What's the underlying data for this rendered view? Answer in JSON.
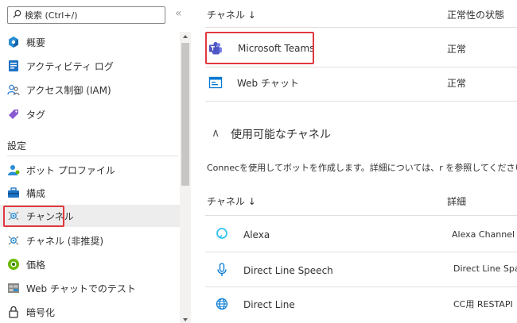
{
  "sidebar": {
    "search_placeholder": "検索 (Ctrl+/)",
    "collapse_glyph": "«",
    "items_top": [
      {
        "label": "概要",
        "icon": "overview-icon"
      },
      {
        "label": "アクティビティ ログ",
        "icon": "activity-log-icon"
      },
      {
        "label": "アクセス制御 (IAM)",
        "icon": "access-control-icon"
      },
      {
        "label": "タグ",
        "icon": "tag-icon"
      }
    ],
    "section_title": "設定",
    "items_settings": [
      {
        "label": "ボット プロファイル",
        "icon": "bot-profile-icon"
      },
      {
        "label": "構成",
        "icon": "configuration-icon"
      },
      {
        "label": "チャンネル",
        "icon": "channels-icon"
      },
      {
        "label": "チャネル (非推奨)",
        "icon": "channels-deprecated-icon"
      },
      {
        "label": "価格",
        "icon": "pricing-icon"
      },
      {
        "label": "Web チャットでのテスト",
        "icon": "test-webchat-icon"
      },
      {
        "label": "暗号化",
        "icon": "lock-icon"
      }
    ]
  },
  "main": {
    "table1": {
      "col_channel": "チャネル ↓",
      "col_health": "正常性の状態",
      "rows": [
        {
          "name": "Microsoft Teams",
          "status": "正常"
        },
        {
          "name": "Web チャット",
          "status": "正常"
        }
      ]
    },
    "available": {
      "toggle_glyph": "∧",
      "title": "使用可能なチャネル",
      "description": "Connecを使用してボットを作成します。詳細については、r を参照してください。",
      "col_channel": "チャネル ↓",
      "col_detail": "詳細",
      "rows": [
        {
          "name": "Alexa",
          "detail": "Alexa Channel"
        },
        {
          "name": "Direct Line Speech",
          "detail": "Direct Line Spa"
        },
        {
          "name": "Direct Line",
          "detail": "CC用 RESTAPI"
        }
      ]
    }
  },
  "colors": {
    "accent_red": "#e0393e",
    "selected_bg": "#ededed",
    "teams_purple": "#5b5fc7",
    "azure_blue": "#0078d4"
  }
}
